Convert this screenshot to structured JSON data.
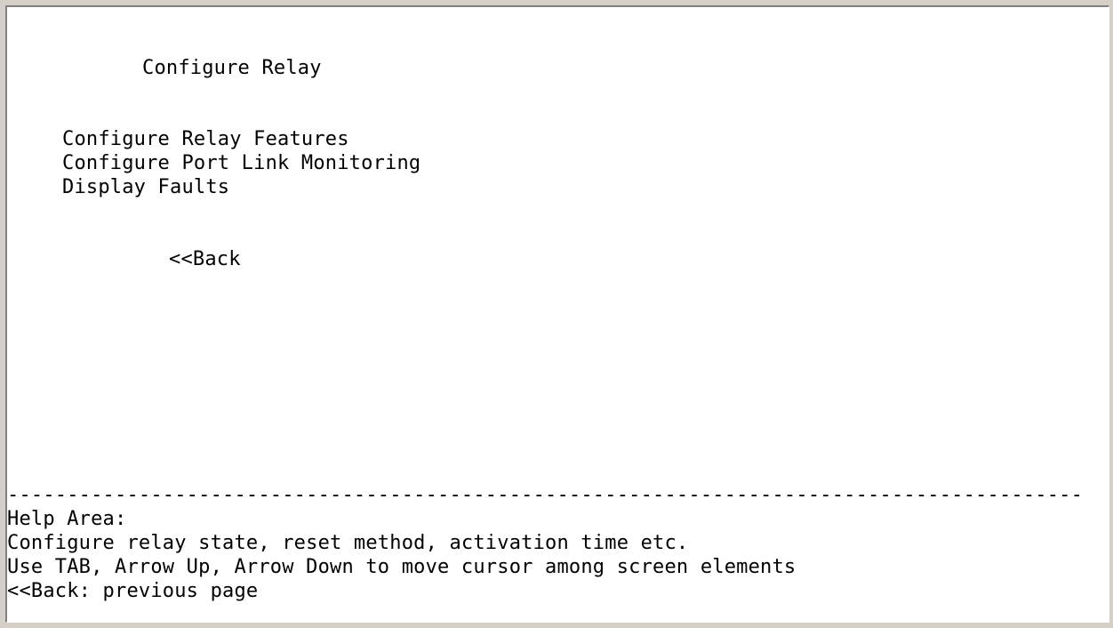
{
  "screen": {
    "title": "Configure Relay"
  },
  "menu": {
    "items": [
      {
        "label": "Configure Relay Features"
      },
      {
        "label": "Configure Port Link Monitoring"
      },
      {
        "label": "Display Faults"
      }
    ],
    "back_label": "<<Back"
  },
  "divider": "---------------------------------------------------------------------------------------------",
  "help": {
    "heading": "Help Area:",
    "lines": [
      "Configure relay state, reset method, activation time etc.",
      "Use TAB, Arrow Up, Arrow Down to move cursor among screen elements",
      "<<Back: previous page"
    ]
  }
}
